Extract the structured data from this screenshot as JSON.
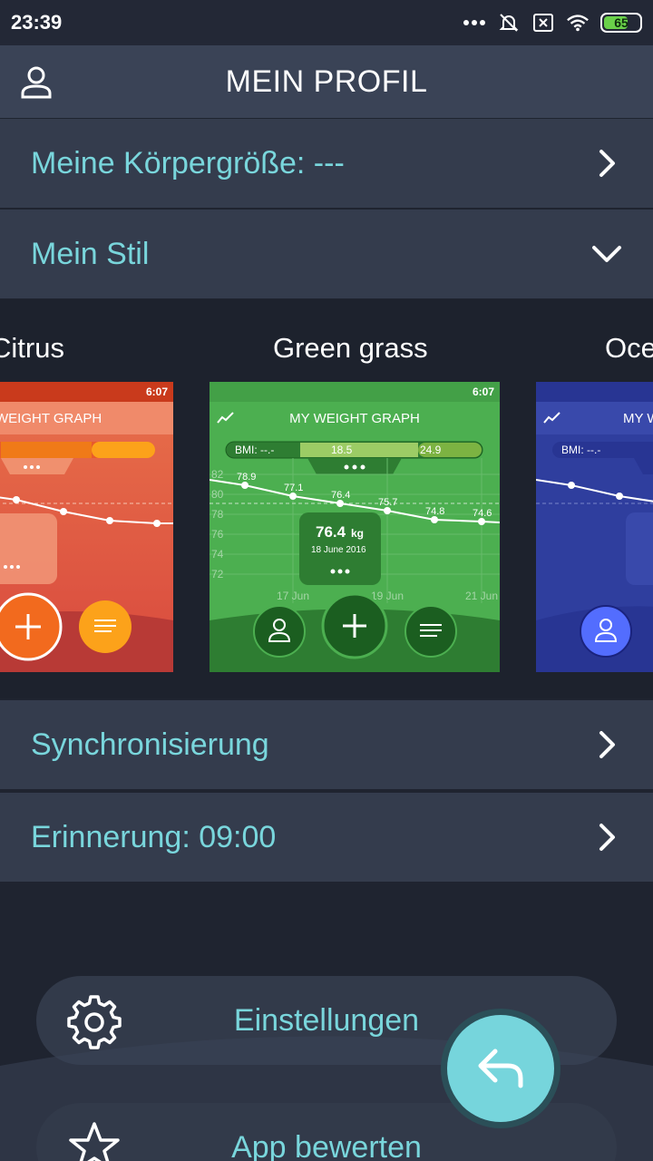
{
  "status_bar": {
    "time": "23:39",
    "battery": "65"
  },
  "header": {
    "title": "MEIN PROFIL"
  },
  "rows": {
    "height": {
      "label": "Meine Körpergröße: ---"
    },
    "style": {
      "label": "Mein Stil"
    },
    "sync": {
      "label": "Synchronisierung"
    },
    "reminder": {
      "label": "Erinnerung: 09:00"
    }
  },
  "styles": {
    "left": {
      "name": "Citrus",
      "title": "WEIGHT GRAPH",
      "time": "6:07"
    },
    "center": {
      "name": "Green grass",
      "title": "MY WEIGHT GRAPH",
      "time": "6:07",
      "bmi": "BMI: --.-",
      "bmi_low": "18.5",
      "bmi_high": "24.9",
      "weight": "76.4",
      "unit": "kg",
      "date": "18 June 2016",
      "points": [
        "78.9",
        "77.1",
        "76.4",
        "75.7",
        "74.8",
        "74.6"
      ],
      "y_ticks": [
        "82",
        "80",
        "78",
        "76",
        "74",
        "72"
      ],
      "x_ticks": [
        "17 Jun",
        "19 Jun",
        "21 Jun"
      ]
    },
    "right": {
      "name": "Ocean",
      "title": "MY W",
      "bmi": "BMI: --.-"
    }
  },
  "actions": {
    "settings": {
      "label": "Einstellungen",
      "icon": "gear-icon"
    },
    "rate": {
      "label": "App bewerten",
      "icon": "star-icon"
    },
    "back": {
      "icon": "reply-icon"
    }
  },
  "colors": {
    "accent": "#79d6dc",
    "row_bg": "#343c4d",
    "app_bar": "#3a4356",
    "background": "#1f2430"
  }
}
